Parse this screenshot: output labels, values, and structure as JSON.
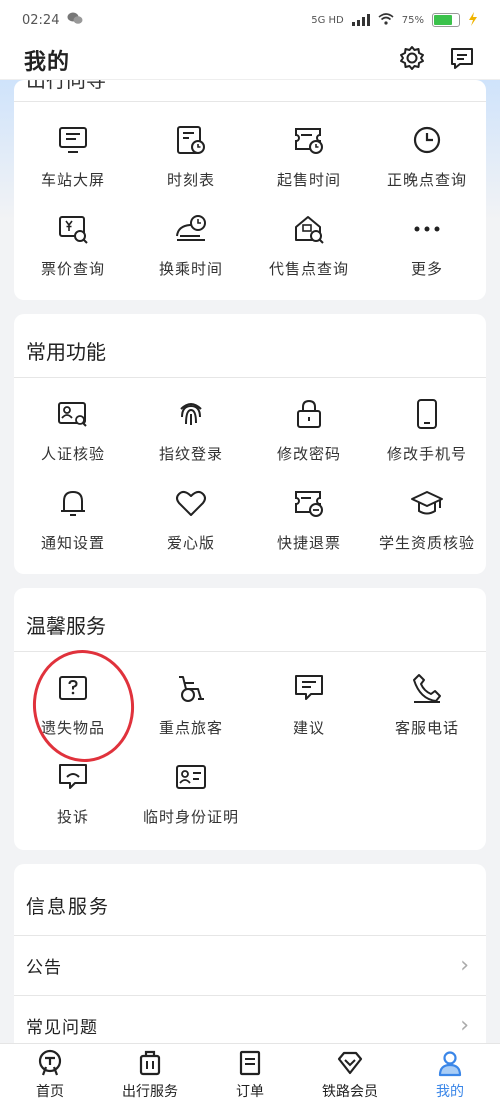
{
  "status_bar": {
    "time": "02:24",
    "network": "5G HD",
    "battery": "75%"
  },
  "header": {
    "title": "我的"
  },
  "section_top": {
    "title": "出行向导",
    "items": [
      {
        "label": "车站大屏",
        "icon": "station-screen-icon"
      },
      {
        "label": "时刻表",
        "icon": "timetable-icon"
      },
      {
        "label": "起售时间",
        "icon": "sale-time-icon"
      },
      {
        "label": "正晚点查询",
        "icon": "clock-icon"
      },
      {
        "label": "票价查询",
        "icon": "fare-search-icon"
      },
      {
        "label": "换乘时间",
        "icon": "transfer-time-icon"
      },
      {
        "label": "代售点查询",
        "icon": "agency-search-icon"
      },
      {
        "label": "更多",
        "icon": "more-icon"
      }
    ]
  },
  "common": {
    "title": "常用功能",
    "items": [
      {
        "label": "人证核验",
        "icon": "id-verify-icon"
      },
      {
        "label": "指纹登录",
        "icon": "fingerprint-icon"
      },
      {
        "label": "修改密码",
        "icon": "lock-icon"
      },
      {
        "label": "修改手机号",
        "icon": "phone-icon"
      },
      {
        "label": "通知设置",
        "icon": "bell-icon"
      },
      {
        "label": "爱心版",
        "icon": "heart-icon"
      },
      {
        "label": "快捷退票",
        "icon": "quick-refund-icon"
      },
      {
        "label": "学生资质核验",
        "icon": "graduation-cap-icon"
      }
    ]
  },
  "warm": {
    "title": "温馨服务",
    "items": [
      {
        "label": "遗失物品",
        "icon": "lost-item-icon"
      },
      {
        "label": "重点旅客",
        "icon": "wheelchair-icon"
      },
      {
        "label": "建议",
        "icon": "suggestion-icon"
      },
      {
        "label": "客服电话",
        "icon": "phone-call-icon"
      },
      {
        "label": "投诉",
        "icon": "complaint-icon"
      },
      {
        "label": "临时身份证明",
        "icon": "temp-id-icon"
      }
    ]
  },
  "info": {
    "title": "信息服务",
    "rows": [
      {
        "label": "公告"
      },
      {
        "label": "常见问题"
      }
    ]
  },
  "tabbar": {
    "tabs": [
      {
        "label": "首页",
        "icon": "home-train-icon"
      },
      {
        "label": "出行服务",
        "icon": "luggage-icon"
      },
      {
        "label": "订单",
        "icon": "order-icon"
      },
      {
        "label": "铁路会员",
        "icon": "member-diamond-icon"
      },
      {
        "label": "我的",
        "icon": "user-icon",
        "active": true
      }
    ]
  },
  "colors": {
    "accent": "#3a86e8",
    "annotation": "#e0323c",
    "battery": "#3bc24b"
  }
}
